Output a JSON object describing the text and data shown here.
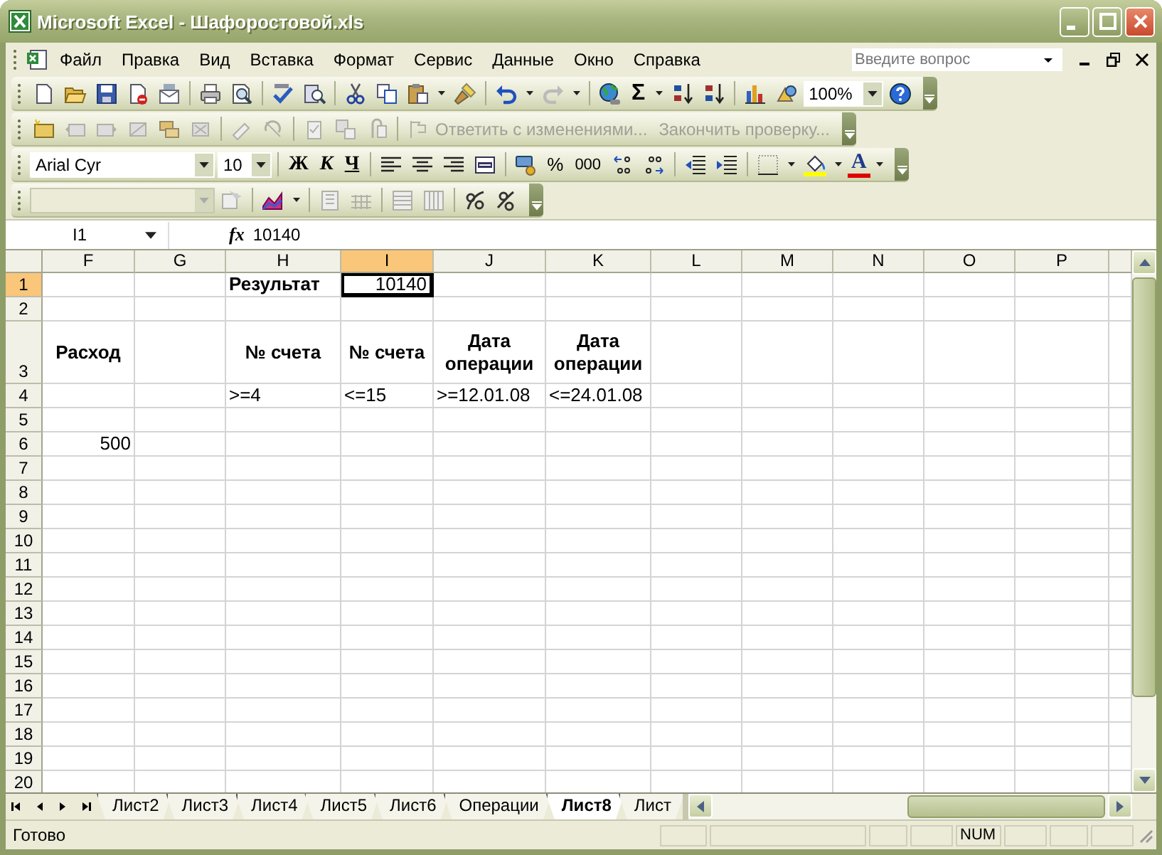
{
  "window": {
    "title": "Microsoft Excel - Шафоростовой.xls"
  },
  "menu": {
    "items": [
      "Файл",
      "Правка",
      "Вид",
      "Вставка",
      "Формат",
      "Сервис",
      "Данные",
      "Окно",
      "Справка"
    ],
    "help_search": {
      "placeholder": "Введите вопрос"
    }
  },
  "standard_toolbar": {
    "sum": "Σ",
    "zoom": "100%"
  },
  "reviewing_toolbar": {
    "reply": {
      "label": "Ответить с изменениями...",
      "disabled": true
    },
    "finish": {
      "label": "Закончить проверку...",
      "disabled": true
    }
  },
  "formatting_toolbar": {
    "font": "Arial Cyr",
    "size": "10",
    "bold": "Ж",
    "italic": "К",
    "underline": "Ч",
    "percent": "%",
    "thousands": "000",
    "font_color_letter": "A"
  },
  "formula_bar": {
    "name_box": "I1",
    "fx": "fx",
    "value": "10140"
  },
  "sheet": {
    "columns": [
      {
        "label": "F",
        "selected": false
      },
      {
        "label": "G",
        "selected": false
      },
      {
        "label": "H",
        "selected": false
      },
      {
        "label": "I",
        "selected": true
      },
      {
        "label": "J",
        "selected": false
      },
      {
        "label": "K",
        "selected": false
      },
      {
        "label": "L",
        "selected": false
      },
      {
        "label": "M",
        "selected": false
      },
      {
        "label": "N",
        "selected": false
      },
      {
        "label": "O",
        "selected": false
      },
      {
        "label": "P",
        "selected": false
      }
    ],
    "rows": [
      {
        "number": "1",
        "selected": true,
        "tall": false,
        "cells": [
          {},
          {},
          {
            "text": "Результат",
            "kind": "text",
            "bold": true
          },
          {
            "text": "10140",
            "kind": "number",
            "bold": false
          }
        ]
      },
      {
        "number": "2",
        "selected": false,
        "tall": false,
        "cells": []
      },
      {
        "number": "3",
        "selected": false,
        "tall": true,
        "cells": [
          {
            "text": "Расход",
            "kind": "heading",
            "bold": true
          },
          {},
          {
            "text": "№ счета",
            "kind": "heading",
            "bold": true
          },
          {
            "text": "№ счета",
            "kind": "heading",
            "bold": true
          },
          {
            "text": "Дата операции",
            "kind": "heading",
            "bold": true
          },
          {
            "text": "Дата операции",
            "kind": "heading",
            "bold": true
          }
        ]
      },
      {
        "number": "4",
        "selected": false,
        "tall": false,
        "cells": [
          {},
          {},
          {
            "text": ">=4",
            "kind": "text",
            "bold": false
          },
          {
            "text": "<=15",
            "kind": "text",
            "bold": false
          },
          {
            "text": ">=12.01.08",
            "kind": "text",
            "bold": false
          },
          {
            "text": "<=24.01.08",
            "kind": "text",
            "bold": false
          }
        ]
      },
      {
        "number": "5",
        "selected": false,
        "tall": false,
        "cells": []
      },
      {
        "number": "6",
        "selected": false,
        "tall": false,
        "cells": [
          {
            "text": "500",
            "kind": "number",
            "bold": false
          }
        ]
      },
      {
        "number": "7",
        "selected": false,
        "tall": false,
        "cells": []
      },
      {
        "number": "8",
        "selected": false,
        "tall": false,
        "cells": []
      },
      {
        "number": "9",
        "selected": false,
        "tall": false,
        "cells": []
      },
      {
        "number": "10",
        "selected": false,
        "tall": false,
        "cells": []
      },
      {
        "number": "11",
        "selected": false,
        "tall": false,
        "cells": []
      },
      {
        "number": "12",
        "selected": false,
        "tall": false,
        "cells": []
      },
      {
        "number": "13",
        "selected": false,
        "tall": false,
        "cells": []
      },
      {
        "number": "14",
        "selected": false,
        "tall": false,
        "cells": []
      },
      {
        "number": "15",
        "selected": false,
        "tall": false,
        "cells": []
      },
      {
        "number": "16",
        "selected": false,
        "tall": false,
        "cells": []
      },
      {
        "number": "17",
        "selected": false,
        "tall": false,
        "cells": []
      },
      {
        "number": "18",
        "selected": false,
        "tall": false,
        "cells": []
      },
      {
        "number": "19",
        "selected": false,
        "tall": false,
        "cells": []
      },
      {
        "number": "20",
        "selected": false,
        "tall": false,
        "cells": []
      }
    ]
  },
  "sheet_tabs": [
    {
      "label": "Лист2",
      "selected": false
    },
    {
      "label": "Лист3",
      "selected": false
    },
    {
      "label": "Лист4",
      "selected": false
    },
    {
      "label": "Лист5",
      "selected": false
    },
    {
      "label": "Лист6",
      "selected": false
    },
    {
      "label": "Операции",
      "selected": false
    },
    {
      "label": "Лист8",
      "selected": true
    },
    {
      "label": "Лист",
      "selected": false
    }
  ],
  "status_bar": {
    "text": "Готово",
    "indicators": [
      "NUM"
    ]
  }
}
